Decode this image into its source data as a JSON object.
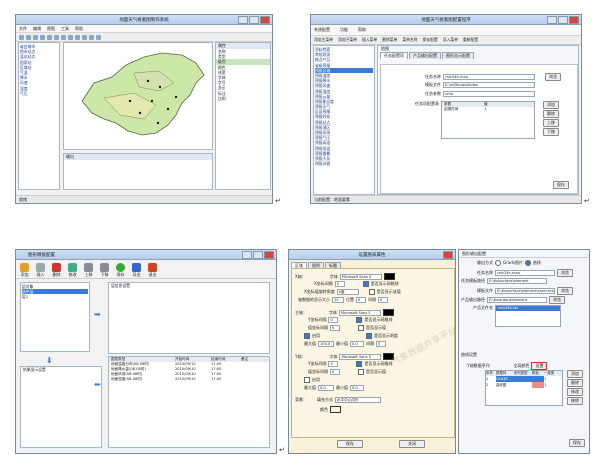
{
  "colors": {
    "accent": "#2f7be0",
    "title_bar": "#b6cdea",
    "close": "#d6453b",
    "highlight": "#3a7bd5"
  },
  "s1": {
    "title": "地面天气要素图制作系统",
    "menu": [
      "文件",
      "编辑",
      "视图",
      "工具",
      "帮助"
    ],
    "tree_items": [
      "省会城市",
      "地市站点",
      "县站站点",
      "国家站",
      "区域站",
      "气温",
      "降水",
      "风速",
      "湿度",
      "气压"
    ],
    "props_title": "属性",
    "props_rows": [
      "名称",
      "类型",
      "级别",
      "颜色",
      "线宽",
      "字体",
      "字号",
      "显示",
      "标注",
      "比例"
    ],
    "bottom_panel": "输出",
    "status": "就绪"
  },
  "s2": {
    "title": "地面天气要素图配置程序",
    "menu_items": [
      "系统配置",
      "功能",
      "帮助"
    ],
    "tool_items": [
      "添加主菜单",
      "添加子菜单",
      "插入菜单",
      "删除菜单",
      "菜单名称",
      "保存配置",
      "导入菜单",
      "重新配置"
    ],
    "tree_items": [
      "资料检索",
      "常规观测",
      "格点产品",
      "省级预报",
      "预报区域",
      "预报温度",
      "预报降水",
      "预报风速",
      "预报湿度",
      "预报云量",
      "预报能见度",
      "预报天气",
      "区县预报",
      "预报时效",
      "预报站点",
      "预报落区",
      "预报风场",
      "预报气压",
      "预报高温",
      "预报低温",
      "预报雷暴",
      "预报大风",
      "预报冰雹"
    ],
    "tab_title": "地图",
    "tabs": [
      "任务配置项",
      "产品输出配置",
      "图形显示配置"
    ],
    "fields": [
      {
        "label": "任务名称",
        "value": "rain24h.mxa"
      },
      {
        "label": "模板文件",
        "value": "E:\\m\\Micaps\\Index"
      },
      {
        "label": "任务参数",
        "value": "uma"
      }
    ],
    "table_label": "任务项配置表",
    "table_header": [
      "参数",
      "值"
    ],
    "table_row": [
      "起报时间",
      "1"
    ],
    "side_buttons": [
      "添加",
      "删除",
      "上移",
      "下移"
    ],
    "browse": "浏览",
    "save": "保存",
    "status": "当前配置：地面要素"
  },
  "s3": {
    "title": "图形模板配置",
    "toolbar": [
      "添加",
      "插入",
      "删除",
      "修改",
      "上移",
      "下移",
      "保存",
      "导出",
      "退出"
    ],
    "left_list_title": "层对象",
    "left_items": [
      "选中层",
      "层1"
    ],
    "right_top_title": "层信息设置",
    "table_header": [
      "图层类型",
      "开始时间",
      "结束时间",
      "备注"
    ],
    "table_rows": [
      [
        "地面温度分布(08-08时)",
        "2015/09/10",
        "17:00"
      ],
      [
        "地面降水量(08-08时)",
        "2015/09/10",
        "17:00"
      ],
      [
        "地面风场(08-08时)",
        "2015/09/10",
        "17:00"
      ],
      [
        "地面湿度(08-08时)",
        "2015/09/10",
        "17:00"
      ]
    ],
    "bottom_left_title": "结果显示设置"
  },
  "s4": {
    "title": "设置图表属性",
    "tabs": [
      "区域",
      "图例",
      "标题"
    ],
    "section_x": "X轴：",
    "section_main": "主轴：",
    "section_y": "Y轴：",
    "section_bg": "背景：",
    "font_label": "字体",
    "font_value": "Microsoft Sans S",
    "labels": [
      "X坐标间隔",
      "X坐标值旋转角度",
      "轴数据的显示大小",
      "Y坐标间隔",
      "值坐标间隔",
      "启用",
      "最大值",
      "最小值"
    ],
    "angle": "0度",
    "size": "10",
    "pos": "位置",
    "interval": "间隔",
    "checks": [
      "是否显示网格线",
      "是否显示该值",
      "是否显示值",
      "是否显示刻度"
    ],
    "max_value": "100.0",
    "min_value": "0.0",
    "fill_label": "填充方式",
    "fill_value": "水平中心向外",
    "color_label": "颜色",
    "ok": "保存",
    "cancel": "关闭",
    "watermark": "气象数据共享平台"
  },
  "s5": {
    "title": "图形输出配置",
    "radio_label": "输出方式",
    "radio_a": "Grads图片",
    "radio_b": "曲线",
    "fields": [
      {
        "label": "任务名称",
        "value": "rain24h.mxa"
      },
      {
        "label": "任务模板路径",
        "value": "E:\\tis\\surface\\element"
      },
      {
        "label": "模板文件",
        "value": "E:\\tis\\surface\\element\\contr.mxa"
      },
      {
        "label": "产品输出路径",
        "value": "E:\\tis\\output\\element"
      }
    ],
    "product_label": "产品文件名",
    "product_value": "rain24h.txt",
    "curve_group": "曲线设置",
    "series_label": "Y轴数据序列",
    "series_header": [
      "序号",
      "数据列",
      "系列类型",
      "颜色",
      "一致宽"
    ],
    "series_rows": [
      [
        "1",
        "Grid3D",
        "",
        "1"
      ],
      [
        "2",
        "曲线图",
        "",
        "1"
      ]
    ],
    "full_label": "全局颜色",
    "buttons": [
      "浏览",
      "添加",
      "删除",
      "修改",
      "移除"
    ],
    "set": "设置",
    "save": "保存"
  }
}
